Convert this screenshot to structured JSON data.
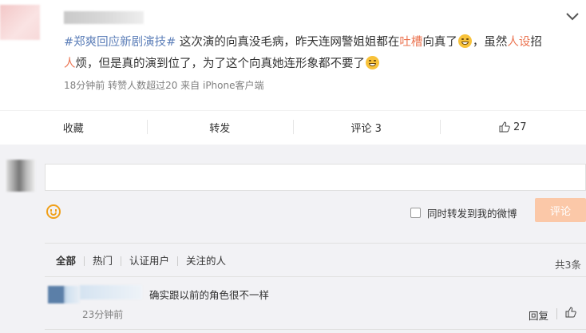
{
  "post": {
    "hashtag": "#郑爽回应新剧演技#",
    "text_1": " 这次演的向真没毛病，昨天连网警姐姐都在",
    "link_tucao": "吐槽",
    "text_2": "向真了",
    "text_3": "，虽然",
    "link_renshe": "人设",
    "text_4": "招",
    "link_ren": "人",
    "text_5": "烦，但是真的演到位了，为了这个向真她连形象都不要了",
    "meta": "18分钟前 转赞人数超过20 来自 iPhone客户端"
  },
  "actions": {
    "favorite": "收藏",
    "repost": "转发",
    "comment": "评论 3",
    "like": "27"
  },
  "composer": {
    "forward_label": "同时转发到我的微博",
    "submit_label": "评论"
  },
  "filters": {
    "items": [
      "全部",
      "热门",
      "认证用户",
      "关注的人"
    ],
    "total": "共3条"
  },
  "comments": [
    {
      "text": "确实跟以前的角色很不一样",
      "time": "23分钟前",
      "reply_label": "回复"
    }
  ],
  "icons": {
    "emoji": "laughing-face-icon",
    "smile": "emoji-picker-icon",
    "thumb": "thumbs-up-icon",
    "chevron": "chevron-down-icon"
  },
  "colors": {
    "link_blue": "#5d7fb9",
    "link_red": "#eb7350",
    "submit_bg": "#fbc8a8"
  }
}
